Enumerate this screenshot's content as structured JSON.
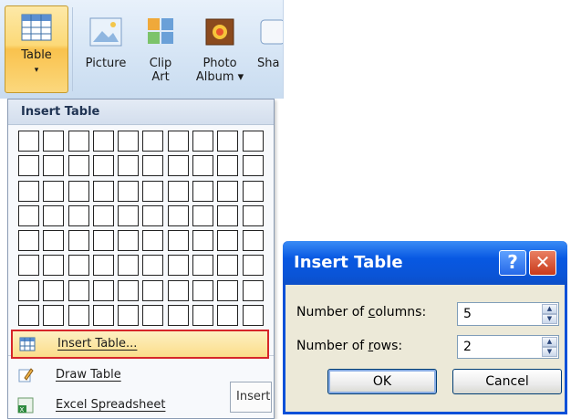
{
  "ribbon": {
    "table": {
      "label": "Table",
      "arrow": "▾"
    },
    "picture": {
      "label": "Picture"
    },
    "clip_art": {
      "line1": "Clip",
      "line2": "Art"
    },
    "photo_album": {
      "line1": "Photo",
      "line2": "Album ▾"
    },
    "shapes": {
      "label": "Sha"
    }
  },
  "menu": {
    "header": "Insert Table",
    "grid": {
      "columns": 10,
      "rows": 8
    },
    "items": [
      {
        "label": "Insert Table...",
        "icon": "table-icon"
      },
      {
        "label": "Draw Table",
        "icon": "pencil-icon"
      },
      {
        "label": "Excel Spreadsheet",
        "icon": "excel-icon"
      }
    ],
    "tooltip": "Insert"
  },
  "dialog": {
    "title": "Insert Table",
    "help": "?",
    "close": "✕",
    "columns_label_pre": "Number of ",
    "columns_label_u": "c",
    "columns_label_post": "olumns:",
    "columns_value": "5",
    "rows_label_pre": "Number of ",
    "rows_label_u": "r",
    "rows_label_post": "ows:",
    "rows_value": "2",
    "ok": "OK",
    "cancel": "Cancel"
  },
  "colors": {
    "accent": "#0a54d6",
    "highlight": "#fbdd8a",
    "selection_border": "#d6262a"
  }
}
